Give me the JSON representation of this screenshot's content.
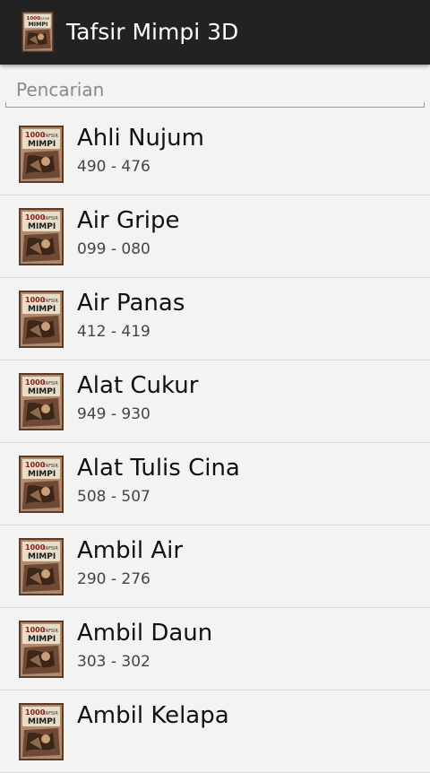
{
  "actionbar": {
    "title": "Tafsir Mimpi 3D",
    "icon": "book-cover-icon"
  },
  "search": {
    "placeholder": "Pencarian",
    "value": ""
  },
  "items": [
    {
      "title": "Ahli Nujum",
      "numbers": "490 - 476"
    },
    {
      "title": "Air Gripe",
      "numbers": "099 - 080"
    },
    {
      "title": "Air Panas",
      "numbers": "412 - 419"
    },
    {
      "title": "Alat Cukur",
      "numbers": "949 - 930"
    },
    {
      "title": "Alat Tulis Cina",
      "numbers": "508 - 507"
    },
    {
      "title": "Ambil Air",
      "numbers": "290 - 276"
    },
    {
      "title": "Ambil Daun",
      "numbers": "303 - 302"
    },
    {
      "title": "Ambil Kelapa",
      "numbers": ""
    }
  ],
  "thumbnail": {
    "line1": "1000",
    "line1b": "TAFSIR",
    "line2": "MIMPI"
  },
  "colors": {
    "actionbar": "#222222",
    "background": "#f3f3f3",
    "divider": "#dcdcdc",
    "title_text": "#111111",
    "sub_text": "#444444"
  }
}
